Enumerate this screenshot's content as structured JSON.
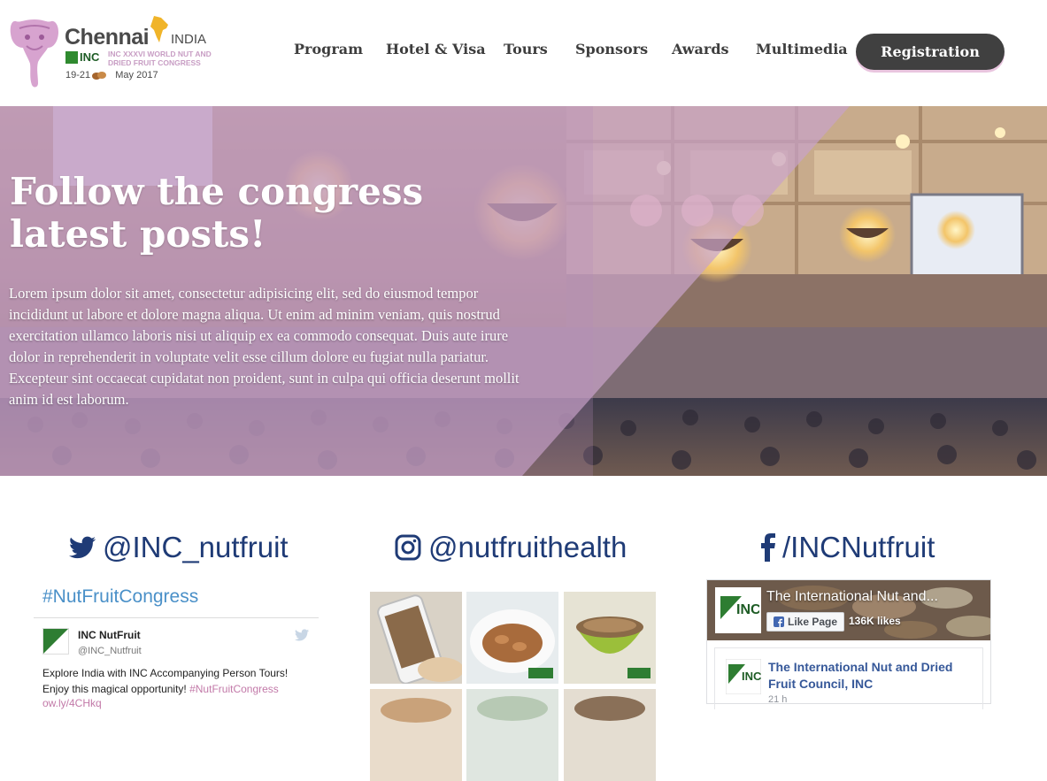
{
  "header": {
    "logo": {
      "city": "Chennai",
      "country": "INDIA",
      "inc": "INC",
      "congress": "INC XXXVI WORLD NUT AND DRIED FRUIT CONGRESS",
      "dates_start": "19-21",
      "dates_end": "May 2017"
    },
    "nav": [
      "Program",
      "Hotel & Visa",
      "Tours",
      "Sponsors",
      "Awards",
      "Multimedia"
    ],
    "registration_label": "Registration"
  },
  "hero": {
    "title_line1": "Follow the congress",
    "title_line2": "latest posts!",
    "body": "Lorem ipsum dolor sit amet, consectetur adipisicing elit, sed do eiusmod tempor incididunt ut labore et dolore magna aliqua. Ut enim ad minim veniam, quis nostrud exercitation ullamco laboris nisi ut aliquip ex ea commodo consequat. Duis aute irure dolor in reprehenderit in voluptate velit esse cillum dolore eu fugiat nulla pariatur. Excepteur sint occaecat cupidatat non proident, sunt in culpa qui officia deserunt mollit anim id est laborum."
  },
  "social": {
    "twitter": {
      "handle": "@INC_nutfruit",
      "hashtag": "#NutFruitCongress",
      "tweet": {
        "name": "INC NutFruit",
        "handle": "@INC_Nutfruit",
        "text_line1": "Explore India with INC Accompanying Person Tours!",
        "text_line2": "Enjoy this magical opportunity!",
        "tag": "#NutFruitCongress",
        "link": "ow.ly/4CHkq"
      }
    },
    "instagram": {
      "handle": "@nutfruithealth",
      "tiles": [
        "phone-nuts",
        "almonds-bowl",
        "pistachio-bowl",
        "nuts-4",
        "nuts-5",
        "nuts-6"
      ]
    },
    "facebook": {
      "handle": "/INCNutfruit",
      "page_name": "The International Nut and...",
      "like_label": "Like Page",
      "likes": "136K likes",
      "post_name": "The International Nut and Dried Fruit Council, INC",
      "post_time": "21 h"
    }
  },
  "colors": {
    "brand_blue": "#1f3b76",
    "accent_pink": "#c279a8",
    "hero_tint": "#b48ab8",
    "button_dark": "#404040"
  }
}
